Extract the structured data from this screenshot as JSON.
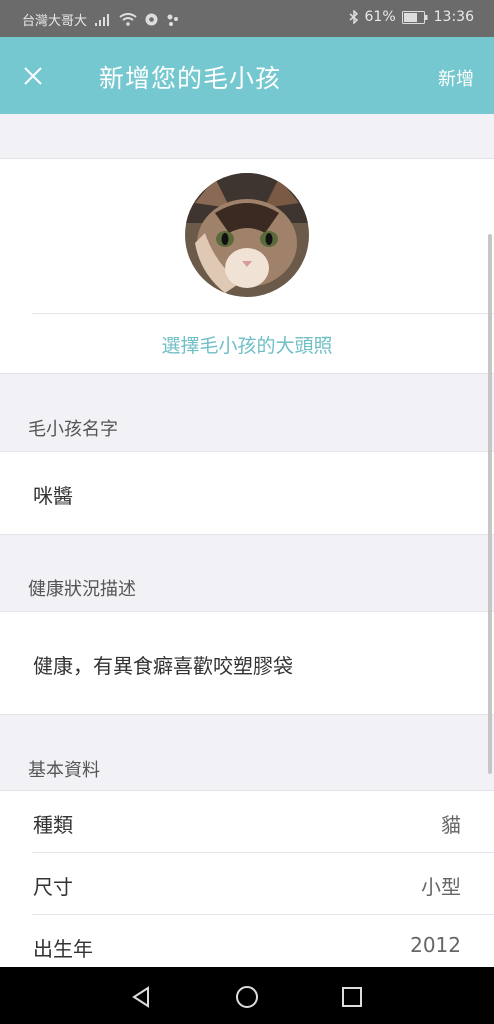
{
  "status_bar": {
    "carrier": "台灣大哥大",
    "battery": "61%",
    "time": "13:36"
  },
  "app_bar": {
    "title": "新增您的毛小孩",
    "action_label": "新增",
    "close_icon": "close-icon"
  },
  "avatar": {
    "choose_label": "選擇毛小孩的大頭照"
  },
  "name_section": {
    "label": "毛小孩名字",
    "value": "咪醬"
  },
  "health_section": {
    "label": "健康狀況描述",
    "value": "健康，有異食癖喜歡咬塑膠袋"
  },
  "basic_section": {
    "label": "基本資料",
    "rows": [
      {
        "key": "種類",
        "value": "貓"
      },
      {
        "key": "尺寸",
        "value": "小型"
      },
      {
        "key": "出生年",
        "value": "2012"
      }
    ]
  },
  "colors": {
    "accent": "#75c8cf",
    "link": "#6fbfc6"
  }
}
